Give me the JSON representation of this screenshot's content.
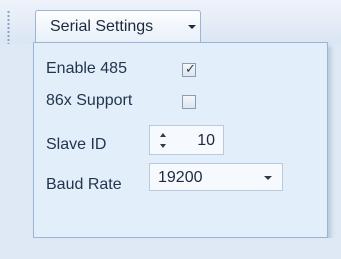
{
  "toolbar": {
    "dropdown_label": "Serial Settings"
  },
  "settings": {
    "enable485": {
      "label": "Enable 485",
      "checked": true
    },
    "support86x": {
      "label": "86x Support",
      "checked": false
    },
    "slave_id": {
      "label": "Slave ID",
      "value": "10"
    },
    "baud_rate": {
      "label": "Baud Rate",
      "value": "19200"
    }
  },
  "icons": {
    "check": "✓"
  },
  "colors": {
    "panel_background": "#e3eefb",
    "border": "#9db5d4",
    "text": "#22354d"
  }
}
